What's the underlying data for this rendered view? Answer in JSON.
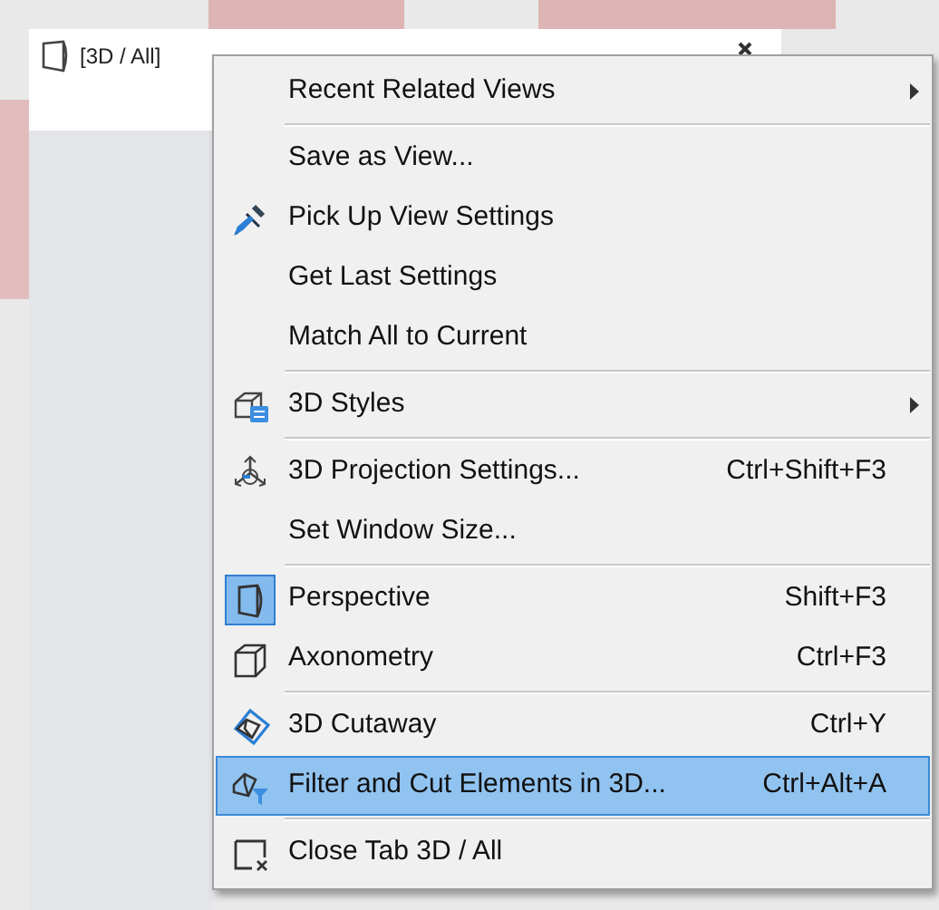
{
  "tab": {
    "title": "[3D / All]"
  },
  "menu": {
    "items": [
      {
        "kind": "item",
        "label": "Recent Related Views",
        "submenu": true,
        "selected": false
      },
      {
        "kind": "separator"
      },
      {
        "kind": "item",
        "label": "Save as View...",
        "selected": false
      },
      {
        "kind": "item",
        "label": "Pick Up View Settings",
        "checked": false,
        "selected": false
      },
      {
        "kind": "item",
        "label": "Get Last Settings",
        "selected": false
      },
      {
        "kind": "item",
        "label": "Match All to Current",
        "selected": false
      },
      {
        "kind": "separator"
      },
      {
        "kind": "item",
        "label": "3D Styles",
        "submenu": true,
        "checked": false,
        "selected": false
      },
      {
        "kind": "separator"
      },
      {
        "kind": "item",
        "label": "3D Projection Settings...",
        "shortcut": "Ctrl+Shift+F3",
        "checked": false,
        "selected": false
      },
      {
        "kind": "item",
        "label": "Set Window Size...",
        "selected": false
      },
      {
        "kind": "separator"
      },
      {
        "kind": "item",
        "label": "Perspective",
        "shortcut": "Shift+F3",
        "checked": true,
        "selected": false
      },
      {
        "kind": "item",
        "label": "Axonometry",
        "shortcut": "Ctrl+F3",
        "checked": false,
        "selected": false
      },
      {
        "kind": "separator"
      },
      {
        "kind": "item",
        "label": "3D Cutaway",
        "shortcut": "Ctrl+Y",
        "checked": false,
        "selected": false
      },
      {
        "kind": "item",
        "label": "Filter and Cut Elements in 3D...",
        "shortcut": "Ctrl+Alt+A",
        "checked": false,
        "selected": true
      },
      {
        "kind": "separator"
      },
      {
        "kind": "item",
        "label": "Close Tab 3D / All",
        "checked": false,
        "selected": false
      }
    ]
  }
}
